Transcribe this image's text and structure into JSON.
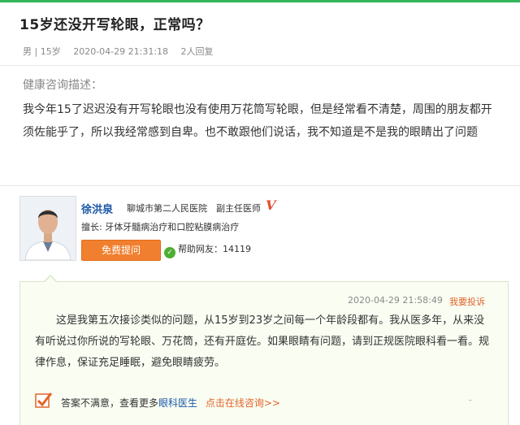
{
  "question": {
    "title": "15岁还没开写轮眼，正常吗？",
    "meta": {
      "gender_age": "男 | 15岁",
      "datetime": "2020-04-29 21:31:18",
      "replies": "2人回复"
    },
    "desc_label": "健康咨询描述：",
    "desc_text": "我今年15了迟迟没有开写轮眼也没有使用万花筒写轮眼，但是经常看不清楚，周围的朋友都开须佐能乎了，所以我经常感到自卑。也不敢跟他们说话，我不知道是不是我的眼睛出了问题"
  },
  "doctor": {
    "name": "徐洪泉",
    "hospital": "聊城市第二人民医院",
    "title": "副主任医师",
    "v_mark": "V",
    "specialty": "擅长: 牙体牙髓病治疗和口腔粘膜病治疗",
    "ask_button": "免费提问",
    "help_icon_glyph": "✓",
    "helped": "帮助网友：14119"
  },
  "answer": {
    "datetime": "2020-04-29 21:58:49",
    "report": "我要投诉",
    "text": "这是我第五次接诊类似的问题，从15岁到23岁之间每一个年龄段都有。我从医多年，从来没有听说过你所说的写轮眼、万花筒，还有开庭佐。如果眼睛有问题，请到正规医院眼科看一看。规律作息，保证充足睡眠，避免眼睛疲劳。",
    "feedback_prefix": "答案不满意，查看更多",
    "feedback_link": "眼科医生",
    "consult": "点击在线咨询>>",
    "dots": "-"
  },
  "colors": {
    "accent_green": "#35b558",
    "link_blue": "#1b57a8",
    "orange": "#f0802f"
  }
}
